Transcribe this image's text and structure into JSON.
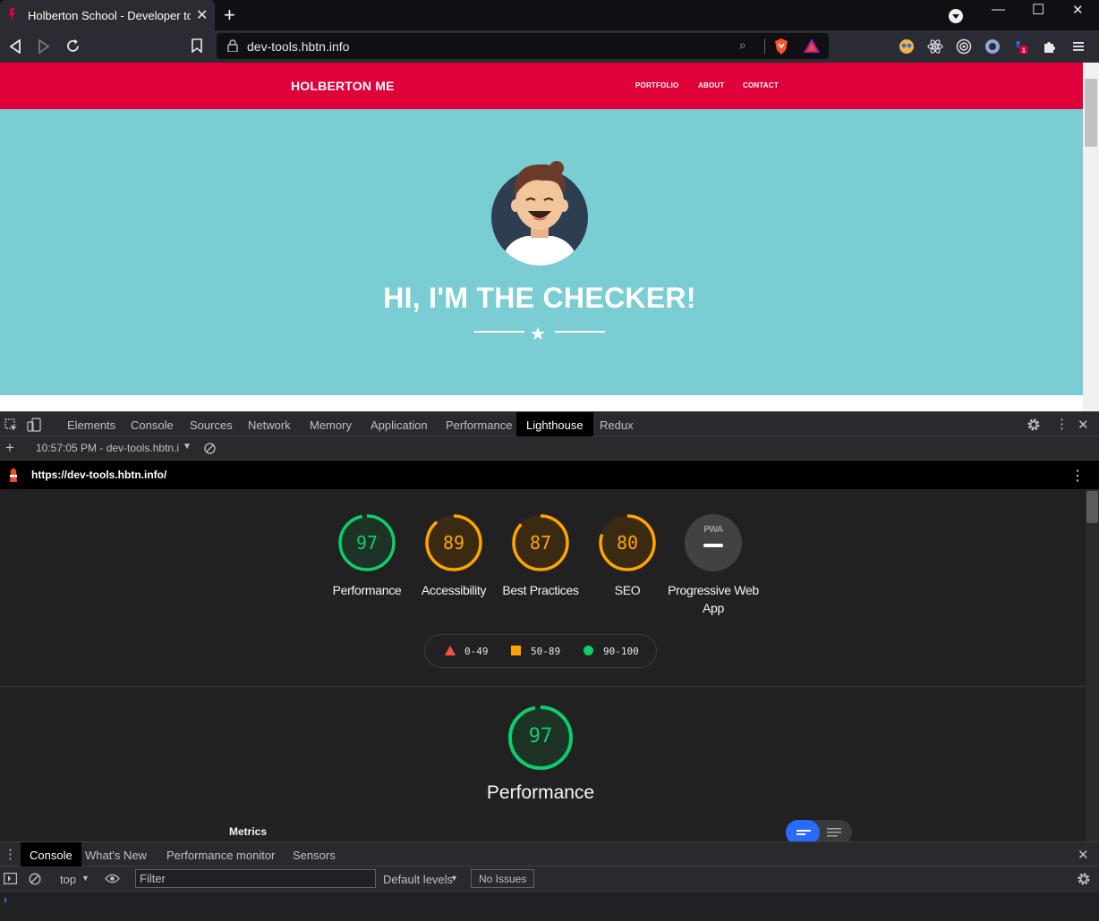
{
  "browser": {
    "tab_title": "Holberton School - Developer tools",
    "url": "dev-tools.hbtn.info"
  },
  "site": {
    "brand": "HOLBERTON ME",
    "nav": [
      "PORTFOLIO",
      "ABOUT",
      "CONTACT"
    ],
    "hero_title": "HI, I'M THE CHECKER!"
  },
  "devtools": {
    "panels": [
      "Elements",
      "Console",
      "Sources",
      "Network",
      "Memory",
      "Application",
      "Performance",
      "Lighthouse",
      "Redux"
    ],
    "active_panel": "Lighthouse",
    "report_time": "10:57:05 PM - dev-tools.hbtn.i",
    "report_url": "https://dev-tools.hbtn.info/"
  },
  "lighthouse": {
    "scores": [
      {
        "label": "Performance",
        "score": 97,
        "color": "#0cce6b"
      },
      {
        "label": "Accessibility",
        "score": 89,
        "color": "#ffa400"
      },
      {
        "label": "Best Practices",
        "score": 87,
        "color": "#ffa400"
      },
      {
        "label": "SEO",
        "score": 80,
        "color": "#ffa400"
      }
    ],
    "pwa": {
      "label": "Progressive Web App",
      "badge_text": "PWA"
    },
    "legend": [
      {
        "range": "0-49",
        "color": "#ff4e42"
      },
      {
        "range": "50-89",
        "color": "#ffa400"
      },
      {
        "range": "90-100",
        "color": "#0cce6b"
      }
    ],
    "section_score": 97,
    "section_title": "Performance",
    "metrics_label": "Metrics"
  },
  "drawer": {
    "tabs": [
      "Console",
      "What's New",
      "Performance monitor",
      "Sensors"
    ],
    "active_tab": "Console",
    "context": "top",
    "filter_placeholder": "Filter",
    "levels": "Default levels",
    "issues": "No Issues",
    "prompt": "›"
  }
}
